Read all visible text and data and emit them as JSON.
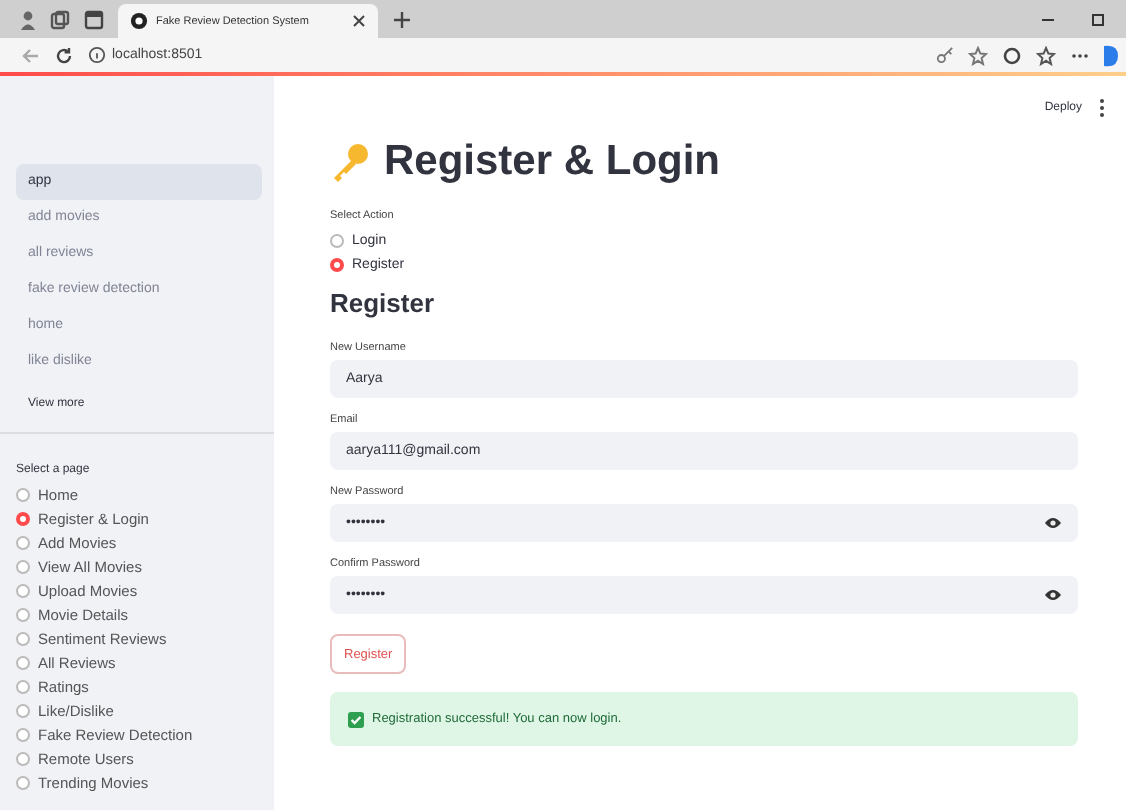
{
  "browser": {
    "tab_title": "Fake Review Detection System",
    "url": "localhost:8501"
  },
  "sidebar": {
    "nav": [
      {
        "label": "app",
        "selected": true
      },
      {
        "label": "add movies",
        "selected": false
      },
      {
        "label": "all reviews",
        "selected": false
      },
      {
        "label": "fake review detection",
        "selected": false
      },
      {
        "label": "home",
        "selected": false
      },
      {
        "label": "like dislike",
        "selected": false
      }
    ],
    "view_more": "View more",
    "page_select": {
      "label": "Select a page",
      "options": [
        {
          "label": "Home",
          "selected": false
        },
        {
          "label": "Register & Login",
          "selected": true
        },
        {
          "label": "Add Movies",
          "selected": false
        },
        {
          "label": "View All Movies",
          "selected": false
        },
        {
          "label": "Upload Movies",
          "selected": false
        },
        {
          "label": "Movie Details",
          "selected": false
        },
        {
          "label": "Sentiment Reviews",
          "selected": false
        },
        {
          "label": "All Reviews",
          "selected": false
        },
        {
          "label": "Ratings",
          "selected": false
        },
        {
          "label": "Like/Dislike",
          "selected": false
        },
        {
          "label": "Fake Review Detection",
          "selected": false
        },
        {
          "label": "Remote Users",
          "selected": false
        },
        {
          "label": "Trending Movies",
          "selected": false
        }
      ]
    }
  },
  "header": {
    "deploy": "Deploy"
  },
  "main": {
    "title": "Register & Login",
    "action": {
      "label": "Select Action",
      "options": [
        {
          "label": "Login",
          "selected": false
        },
        {
          "label": "Register",
          "selected": true
        }
      ]
    },
    "section": "Register",
    "fields": [
      {
        "label": "New Username",
        "value": "Aarya",
        "kind": "text"
      },
      {
        "label": "Email",
        "value": "aarya111@gmail.com",
        "kind": "text"
      },
      {
        "label": "New Password",
        "value": "••••••••",
        "kind": "password"
      },
      {
        "label": "Confirm Password",
        "value": "••••••••",
        "kind": "password"
      }
    ],
    "button": "Register",
    "success": "Registration successful! You can now login."
  }
}
